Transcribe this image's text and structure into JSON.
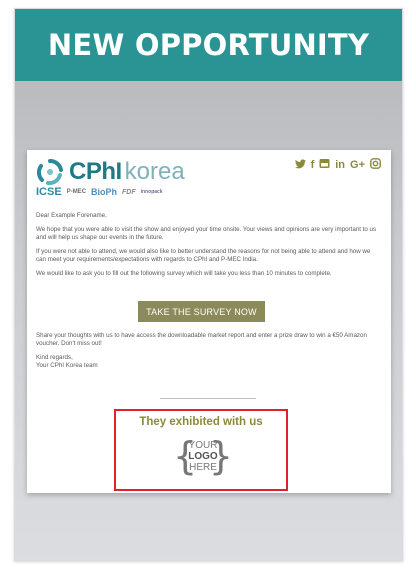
{
  "banner": {
    "title": "NEW OPPORTUNITY"
  },
  "email": {
    "brand": {
      "cphi": "CPhI",
      "korea": "korea"
    },
    "subbrands": [
      "ICSE",
      "P-MEC",
      "BioPh",
      "FDF",
      "innopack"
    ],
    "social_icons": [
      "twitter-icon",
      "facebook-icon",
      "youtube-icon",
      "linkedin-icon",
      "google-plus-icon",
      "instagram-icon"
    ],
    "social_glyphs": {
      "twitter": "🐦",
      "facebook": "f",
      "youtube": "You",
      "linkedin": "in",
      "gplus": "G+",
      "instagram": "◎"
    },
    "greeting": "Dear Example Forename,",
    "para1": "We hope that you were able to visit the show and enjoyed your time onsite. Your views and opinions are very important to us and will help us shape our events in the future.",
    "para2": "If you were not able to attend, we would also like to better understand the reasons for not being able to attend and how we can meet your requirements/expectations with regards to CPhI and P-MEC India.",
    "para3": "We would like to ask you to fill out the following survey which will take you less than 10 minutes to complete.",
    "cta_label": "TAKE THE SURVEY NOW",
    "para4": "Share your thoughts with us to have access the downloadable market report and enter a prize draw to win a €50 Amazon voucher. Don't miss out!",
    "signoff1": "Kind regards,",
    "signoff2": "Your CPhI Korea team",
    "exhibit_title": "They exhibited with us",
    "placeholder_logo": {
      "line1": "YOUR",
      "line2": "LOGO",
      "line3": "HERE"
    }
  },
  "colors": {
    "banner": "#2a9393",
    "accent_olive": "#8a8a3a",
    "cta": "#8a8a5a",
    "highlight_box": "#e0202c"
  }
}
